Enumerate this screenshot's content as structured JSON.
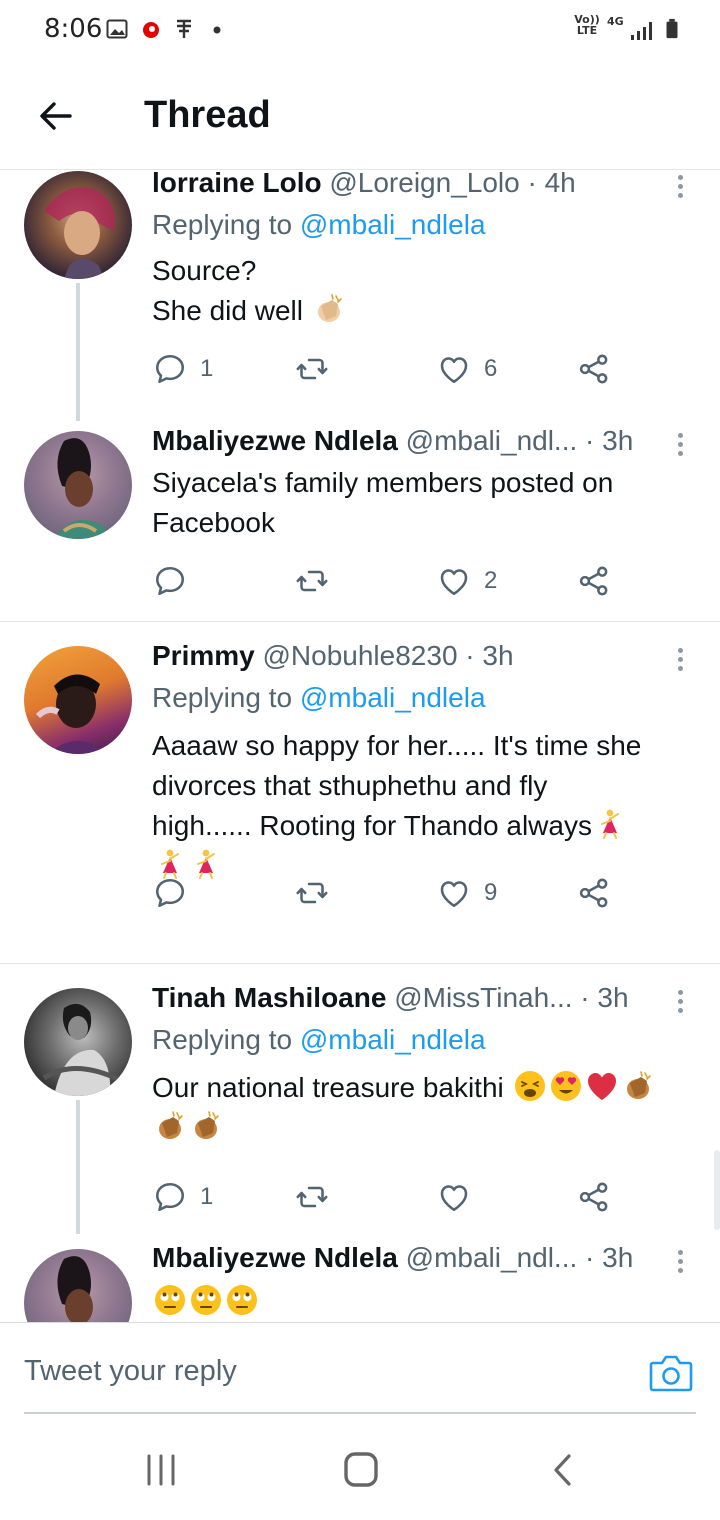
{
  "status_bar": {
    "time": "8:06",
    "network_volte": "Vo)) LTE",
    "network_4g": "4G"
  },
  "header": {
    "title": "Thread"
  },
  "tweets": [
    {
      "name": "lorraine Lolo",
      "handle": "@Loreign_Lolo",
      "sep": "·",
      "time": "4h",
      "replying_prefix": "Replying to",
      "replying_to": "@mbali_ndlela",
      "lines": [
        "Source?",
        "She did well"
      ],
      "replies": "1",
      "likes": "6"
    },
    {
      "name": "Mbaliyezwe Ndlela",
      "handle": "@mbali_ndl...",
      "sep": "·",
      "time": "3h",
      "lines": [
        "Siyacela's family members posted on",
        "Facebook"
      ],
      "likes": "2"
    },
    {
      "name": "Primmy",
      "handle": "@Nobuhle8230",
      "sep": "·",
      "time": "3h",
      "replying_prefix": "Replying to",
      "replying_to": "@mbali_ndlela",
      "lines": [
        "Aaaaw so happy for her..... It's time she",
        "divorces that sthuphethu and fly",
        "high...... Rooting for Thando always"
      ],
      "likes": "9"
    },
    {
      "name": "Tinah Mashiloane",
      "handle": "@MissTinah...",
      "sep": "·",
      "time": "3h",
      "replying_prefix": "Replying to",
      "replying_to": "@mbali_ndlela",
      "lines": [
        "Our national treasure bakithi"
      ],
      "replies": "1"
    },
    {
      "name": "Mbaliyezwe Ndlela",
      "handle": "@mbali_ndl...",
      "sep": "·",
      "time": "3h"
    }
  ],
  "reply_bar": {
    "placeholder": "Tweet your reply"
  },
  "colors": {
    "accent": "#1d9bf0",
    "muted": "#536471",
    "text": "#0f1419",
    "thread_line": "#cfd9de"
  },
  "icons": [
    "back-arrow-icon",
    "reply-icon",
    "retweet-icon",
    "like-icon",
    "share-icon",
    "more-icon",
    "camera-icon",
    "recents-icon",
    "home-icon",
    "nav-back-icon"
  ]
}
